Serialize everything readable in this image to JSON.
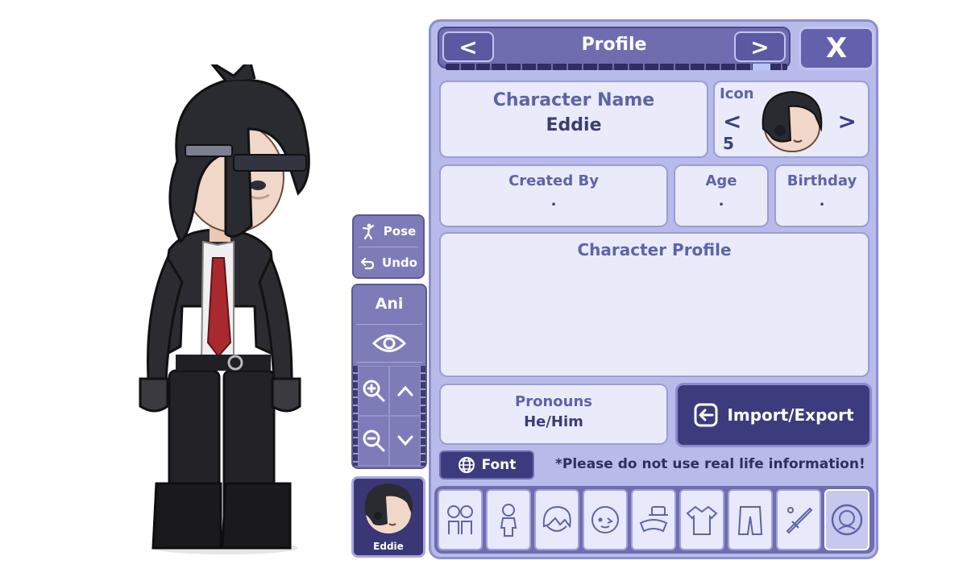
{
  "panel": {
    "title": "Profile",
    "prev_label": "<",
    "next_label": ">",
    "close_label": "X",
    "progress_fraction": 0.95
  },
  "profile": {
    "name_label": "Character Name",
    "name_value": "Eddie",
    "icon_label": "Icon",
    "icon_prev": "<",
    "icon_next": ">",
    "icon_number": "5",
    "created_label": "Created By",
    "created_value": ".",
    "age_label": "Age",
    "age_value": ".",
    "birthday_label": "Birthday",
    "birthday_value": ".",
    "profile_label": "Character Profile",
    "profile_value": "",
    "pronouns_label": "Pronouns",
    "pronouns_value": "He/Him",
    "import_export_label": "Import/Export",
    "font_label": "Font",
    "disclaimer": "*Please do not use real life information!"
  },
  "tools": {
    "pose_label": "Pose",
    "undo_label": "Undo",
    "ani_label": "Ani"
  },
  "avatar": {
    "name": "Eddie"
  },
  "categories": [
    {
      "icon": "characters-icon"
    },
    {
      "icon": "body-icon"
    },
    {
      "icon": "hair-icon"
    },
    {
      "icon": "face-icon"
    },
    {
      "icon": "accessories-icon"
    },
    {
      "icon": "top-icon"
    },
    {
      "icon": "bottom-icon"
    },
    {
      "icon": "props-icon"
    },
    {
      "icon": "profile-icon",
      "active": true
    }
  ],
  "colors": {
    "panel_bg": "#b8bbea",
    "header_bg": "#6f6db0",
    "field_bg": "#e9ebfb",
    "accent_dark": "#3c3b7d",
    "label_text": "#5d64a8"
  }
}
